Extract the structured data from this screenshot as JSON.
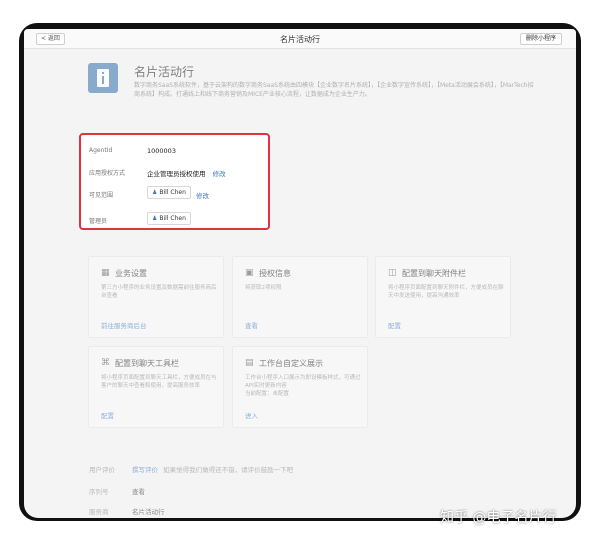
{
  "topbar": {
    "back_label": "< 返回",
    "title": "名片活动行",
    "delete_label": "删除小程序"
  },
  "app": {
    "name": "名片活动行",
    "description": "数字商务SaaS系统软件，基于云架构的数字商务SaaS系统由四模块【企业数字名片系统】，【企业数字宣传系统】，【Meta活动展会系统】，【MarTech招商系统】构成。打通线上和线下商务营销及MICE产业核心流程，让数据成为企业生产力。"
  },
  "info": {
    "agentid_label": "AgentId",
    "agentid_value": "1000003",
    "auth_label": "应用授权方式",
    "auth_value": "企业管理员授权使用",
    "auth_edit": "修改",
    "visible_label": "可见范围",
    "visible_user": "Bill Chen",
    "visible_edit": "修改",
    "admin_label": "管理员",
    "admin_user": "Bill Chen"
  },
  "cards": [
    {
      "icon": "grid-icon",
      "title": "业务设置",
      "desc": "第三方小程序的业务设置及数据需前往服务商后台查看",
      "link": "前往服务商后台"
    },
    {
      "icon": "auth-icon",
      "title": "授权信息",
      "desc": "将获取2项权限",
      "link": "查看"
    },
    {
      "icon": "attachment-icon",
      "title": "配置到聊天附件栏",
      "desc": "将小程序页面配置到聊天附件栏，方便成员在聊天中发送使用，提高沟通效率",
      "link": "配置"
    },
    {
      "icon": "toolbar-icon",
      "title": "配置到聊天工具栏",
      "desc": "将小程序页面配置到聊天工具栏，方便成员在与客户的聊天中查看和使用，提高服务效率",
      "link": "配置"
    },
    {
      "icon": "workbench-icon",
      "title": "工作台自定义展示",
      "badge": "",
      "desc": "工作台小程序入口展示为即设模板样式，可通过API实时更新内容\n当前配置：未配置",
      "link": "进入"
    }
  ],
  "bottom": {
    "rating_label": "用户评价",
    "rating_link": "撰写评价",
    "rating_text": "如果觉得我们做得还不错，请评价鼓励一下吧",
    "serial_label": "序列号",
    "serial_link": "查看",
    "provider_label": "服务商",
    "provider_value": "名片活动行"
  },
  "watermark": "知乎 @电子名片行",
  "colors": {
    "highlight_border": "#e0323f",
    "link": "#3a78c2",
    "app_icon_bg": "#2f6fae"
  }
}
